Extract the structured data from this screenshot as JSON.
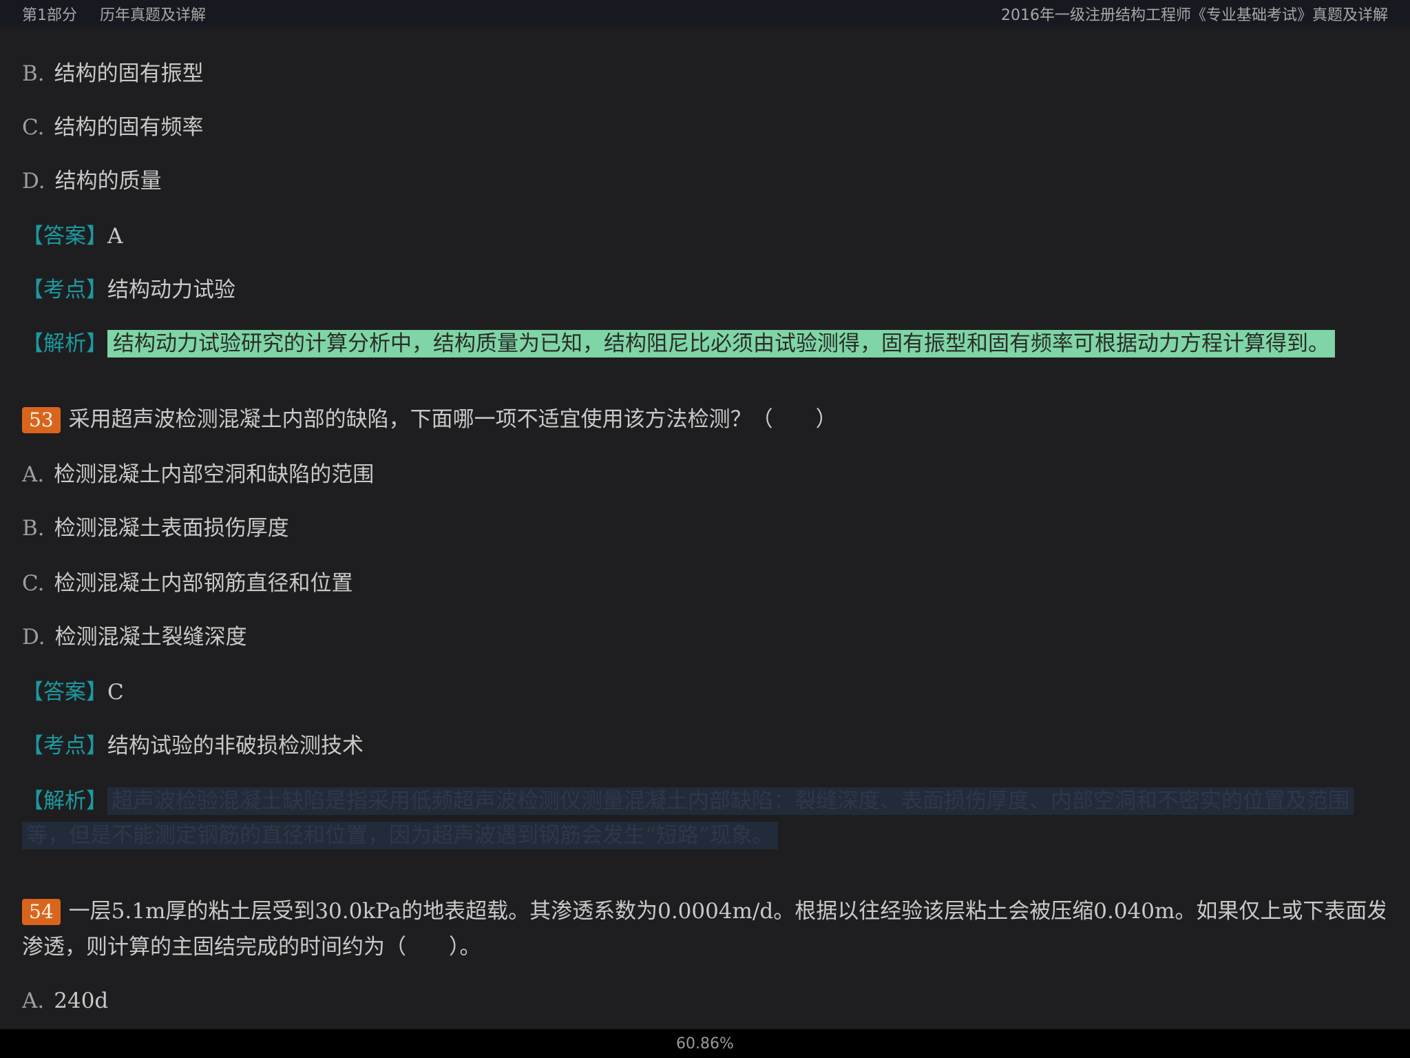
{
  "header": {
    "part": "第1部分",
    "section": "历年真题及详解",
    "book_title": "2016年一级注册结构工程师《专业基础考试》真题及详解"
  },
  "q52": {
    "options": [
      {
        "letter": "B.",
        "text": "结构的固有振型"
      },
      {
        "letter": "C.",
        "text": "结构的固有频率"
      },
      {
        "letter": "D.",
        "text": "结构的质量"
      }
    ],
    "answer_label": "【答案】",
    "answer": "A",
    "point_label": "【考点】",
    "point": "结构动力试验",
    "analysis_label": "【解析】",
    "analysis": "结构动力试验研究的计算分析中，结构质量为已知，结构阻尼比必须由试验测得，固有振型和固有频率可根据动力方程计算得到。"
  },
  "q53": {
    "number": "53",
    "question": "采用超声波检测混凝土内部的缺陷，下面哪一项不适宜使用该方法检测？（　　）",
    "options": [
      {
        "letter": "A.",
        "text": "检测混凝土内部空洞和缺陷的范围"
      },
      {
        "letter": "B.",
        "text": "检测混凝土表面损伤厚度"
      },
      {
        "letter": "C.",
        "text": "检测混凝土内部钢筋直径和位置"
      },
      {
        "letter": "D.",
        "text": "检测混凝土裂缝深度"
      }
    ],
    "answer_label": "【答案】",
    "answer": "C",
    "point_label": "【考点】",
    "point": "结构试验的非破损检测技术",
    "analysis_label": "【解析】",
    "analysis_line1": "超声波检验混凝土缺陷是指采用低频超声波检测仪测量混凝土内部缺陷：裂缝深度、表面损伤厚度、内部空洞和不密实的位置及范围",
    "analysis_line2": "等，但是不能测定钢筋的直径和位置，因为超声波遇到钢筋会发生“短路”现象。"
  },
  "q54": {
    "number": "54",
    "question_line1": "一层5.1m厚的粘土层受到30.0kPa的地表超载。其渗透系数为0.0004m/d。根据以往经验该层粘土会被压缩0.040m。如果仅上或下表面发生",
    "question_line2": "渗透，则计算的主固结完成的时间约为（　　）。",
    "options": [
      {
        "letter": "A.",
        "text": "240d"
      }
    ]
  },
  "footer": {
    "progress": "60.86%"
  }
}
